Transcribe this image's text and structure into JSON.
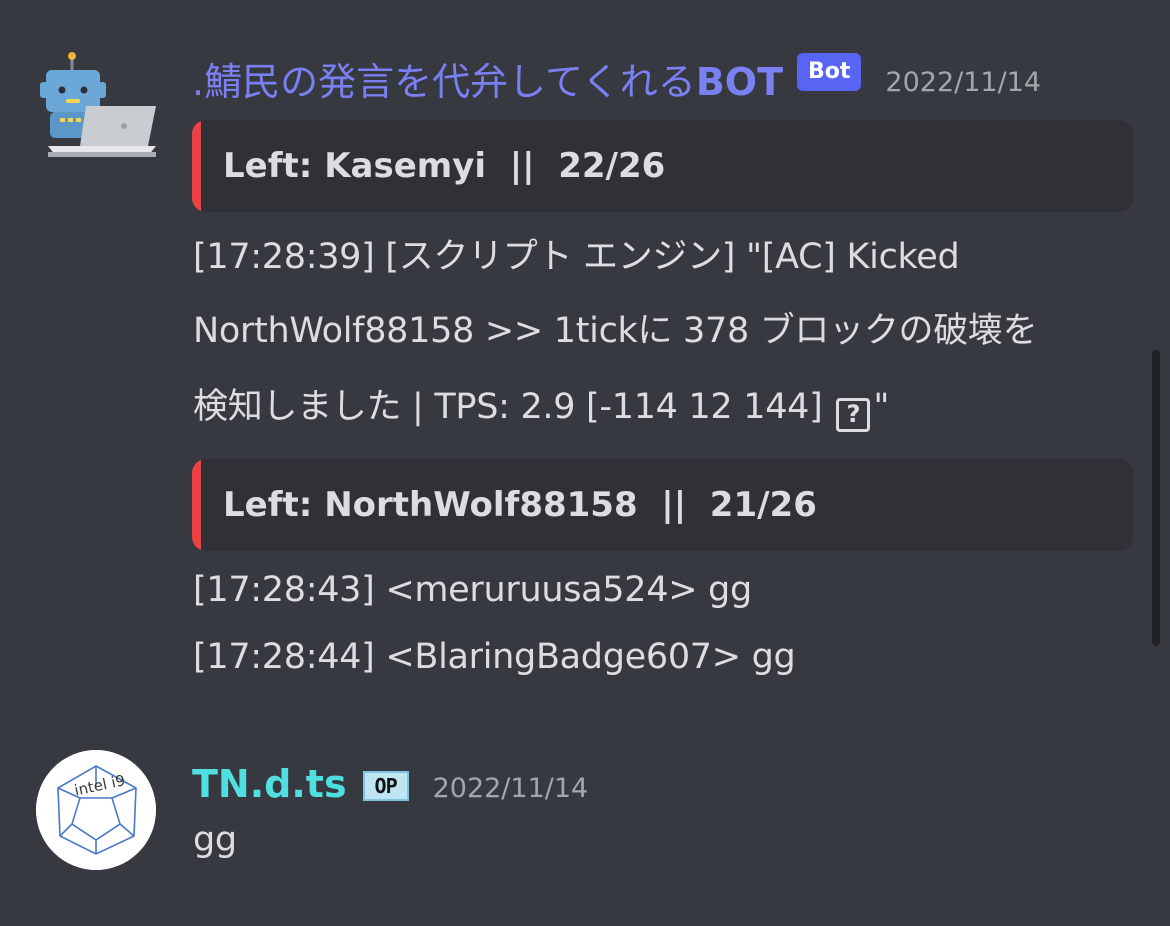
{
  "messages": [
    {
      "author": {
        "name_prefix": ".鯖民の発言を代弁してくれる",
        "name_suffix": "BOT",
        "tag": "Bot",
        "avatar_icon": "robot-laptop-icon"
      },
      "timestamp": "2022/11/14",
      "blocks": {
        "embed1": {
          "title": "Left: Kasemyi  ||  22/26",
          "bar_color": "#ed4245"
        },
        "text1": {
          "line1": "[17:28:39] [スクリプト エンジン] \"[AC] Kicked",
          "line2": "NorthWolf88158 >> 1tickに 378 ブロックの破壊を",
          "line3_before": "検知しました | TPS: 2.9 [-114 12 144] ",
          "line3_glyph": "?",
          "line3_after": "\""
        },
        "embed2": {
          "title": "Left: NorthWolf88158  ||  21/26",
          "bar_color": "#ed4245"
        },
        "text2": {
          "line1": "[17:28:43] <meruruusa524> gg",
          "line2": "[17:28:44] <BlaringBadge607> gg"
        }
      }
    },
    {
      "author": {
        "name": "TN.d.ts",
        "badge": "OP",
        "avatar_icon": "dodecahedron-sketch-icon",
        "avatar_text": "intel i9"
      },
      "timestamp": "2022/11/14",
      "content": "gg"
    }
  ],
  "colors": {
    "background": "#36393f",
    "embed_background": "#2f3136",
    "bot_name": "#7a7ff2",
    "bot_tag": "#5865f2",
    "user_name": "#4fdfe0",
    "text": "#dcddde",
    "timestamp": "#a3a6aa",
    "embed_bar": "#ed4245"
  }
}
